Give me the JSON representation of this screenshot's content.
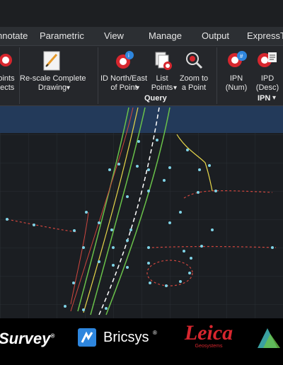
{
  "ribbon_tabs": [
    "nnotate",
    "Parametric",
    "View",
    "Manage",
    "Output",
    "ExpressTo"
  ],
  "buttons": {
    "points_objects": "oints\njects",
    "rescale": "Re-scale Complete\nDrawing",
    "id_north_east": "ID North/East\nof Point",
    "list_points": "List\nPoints",
    "zoom_point": "Zoom to\na Point",
    "ipn": "IPN\n(Num)",
    "ipd": "IPD\n(Desc)"
  },
  "panels": {
    "query": "Query",
    "ipn": "IPN"
  },
  "icons": {
    "rescale": "rescale-drawing-icon",
    "id_north_east": "id-point-icon",
    "list_points": "list-points-icon",
    "zoom_point": "zoom-point-icon",
    "ipn": "ipn-icon",
    "ipd": "ipd-icon",
    "dropdown": "▾"
  },
  "footer": {
    "survey": "Survey",
    "bricsys": "Bricsys",
    "leica": "Leica",
    "leica_sub": "Geosystems",
    "reg": "®"
  },
  "colors": {
    "accent_blue": "#2e86de",
    "leica_red": "#d7262e",
    "line_green": "#6ac24a",
    "line_yellow": "#e8d84a",
    "line_red": "#d0463e",
    "point_cyan": "#7fd3e6"
  }
}
